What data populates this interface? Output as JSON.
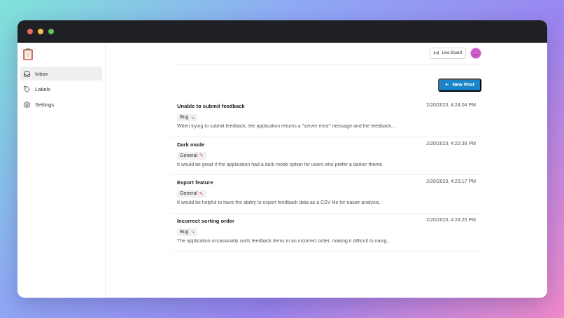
{
  "window": {
    "controls": [
      "close",
      "minimize",
      "maximize"
    ]
  },
  "sidebar": {
    "logo_icon": "clipboard-icon",
    "items": [
      {
        "label": "Inbox",
        "icon": "inbox-icon",
        "active": true
      },
      {
        "label": "Labels",
        "icon": "tag-icon",
        "active": false
      },
      {
        "label": "Settings",
        "icon": "gear-icon",
        "active": false
      }
    ]
  },
  "header": {
    "live_board_label": "Live Board",
    "live_board_icon": "broadcast-icon",
    "avatar_icon": "smiley-avatar"
  },
  "toolbar": {
    "new_post_label": "New Post"
  },
  "posts": [
    {
      "title": "Unable to submit feedback",
      "timestamp": "2/20/2023, 4:24:04 PM",
      "tag": "Bug",
      "tag_icon": "bug-icon",
      "description": "When trying to submit feedback, the application returns a \"server error\" message and the feedback..."
    },
    {
      "title": "Dark mode",
      "timestamp": "2/20/2023, 4:22:38 PM",
      "tag": "General",
      "tag_icon": "pencil-icon",
      "description": "It would be great if the application had a dark mode option for users who prefer a darker theme."
    },
    {
      "title": "Export feature",
      "timestamp": "2/20/2023, 4:23:17 PM",
      "tag": "General",
      "tag_icon": "pencil-icon",
      "description": "It would be helpful to have the ability to export feedback data as a CSV file for easier analysis."
    },
    {
      "title": "Incorrect sorting order",
      "timestamp": "2/20/2023, 4:24:25 PM",
      "tag": "Bug",
      "tag_icon": "bug-icon",
      "description": "The application occasionally sorts feedback items in an incorrect order, making it difficult to navig..."
    }
  ],
  "colors": {
    "accent": "#1a85c9",
    "titlebar": "#1f2023",
    "bug_tag_icon": "#3da44a",
    "general_tag_icon": "#d7554b"
  }
}
